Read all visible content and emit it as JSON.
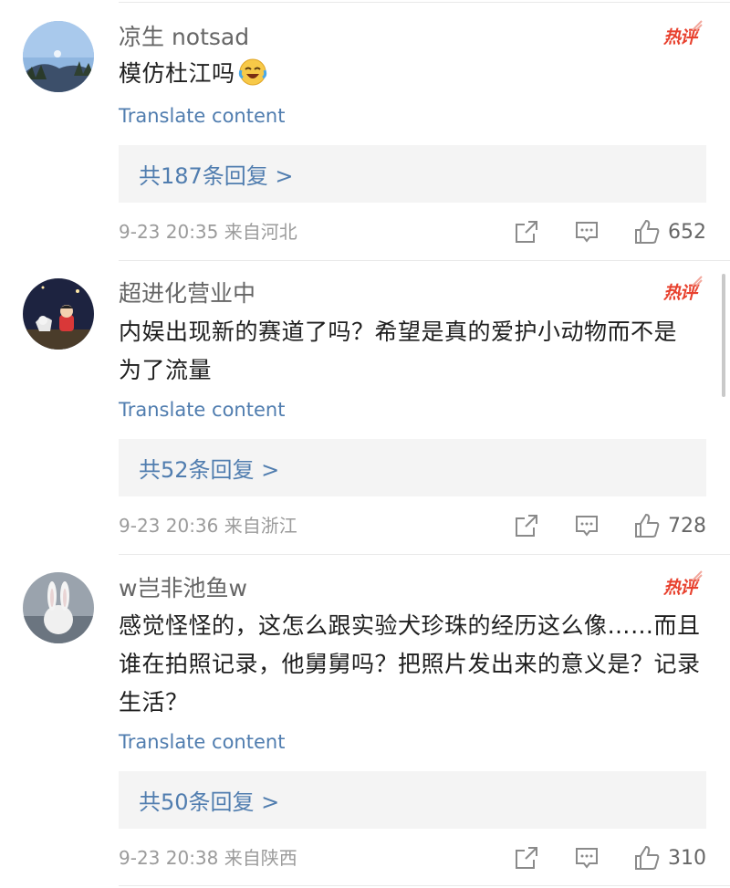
{
  "comments": [
    {
      "username": "凉生 notsad",
      "badge": "热评",
      "text": "模仿杜江吗",
      "emoji": "laughing-crying-emoji",
      "translate": "Translate content",
      "replies": "共187条回复 >",
      "time_location": "9-23 20:35  来自河北",
      "likes": "652"
    },
    {
      "username": "超进化营业中",
      "badge": "热评",
      "text": "内娱出现新的赛道了吗？希望是真的爱护小动物而不是为了流量",
      "translate": "Translate content",
      "replies": "共52条回复 >",
      "time_location": "9-23 20:36  来自浙江",
      "likes": "728"
    },
    {
      "username": "w岂非池鱼w",
      "badge": "热评",
      "text": "感觉怪怪的，这怎么跟实验犬珍珠的经历这么像……而且谁在拍照记录，他舅舅吗？把照片发出来的意义是？记录生活？",
      "translate": "Translate content",
      "replies": "共50条回复 >",
      "time_location": "9-23 20:38  来自陕西",
      "likes": "310"
    }
  ],
  "colors": {
    "link": "#507daf",
    "hot_badge": "#e8412e",
    "meta": "#9b9b9b",
    "reply_bg": "#f4f4f4"
  },
  "icons": [
    "share-icon",
    "comment-icon",
    "like-icon"
  ]
}
